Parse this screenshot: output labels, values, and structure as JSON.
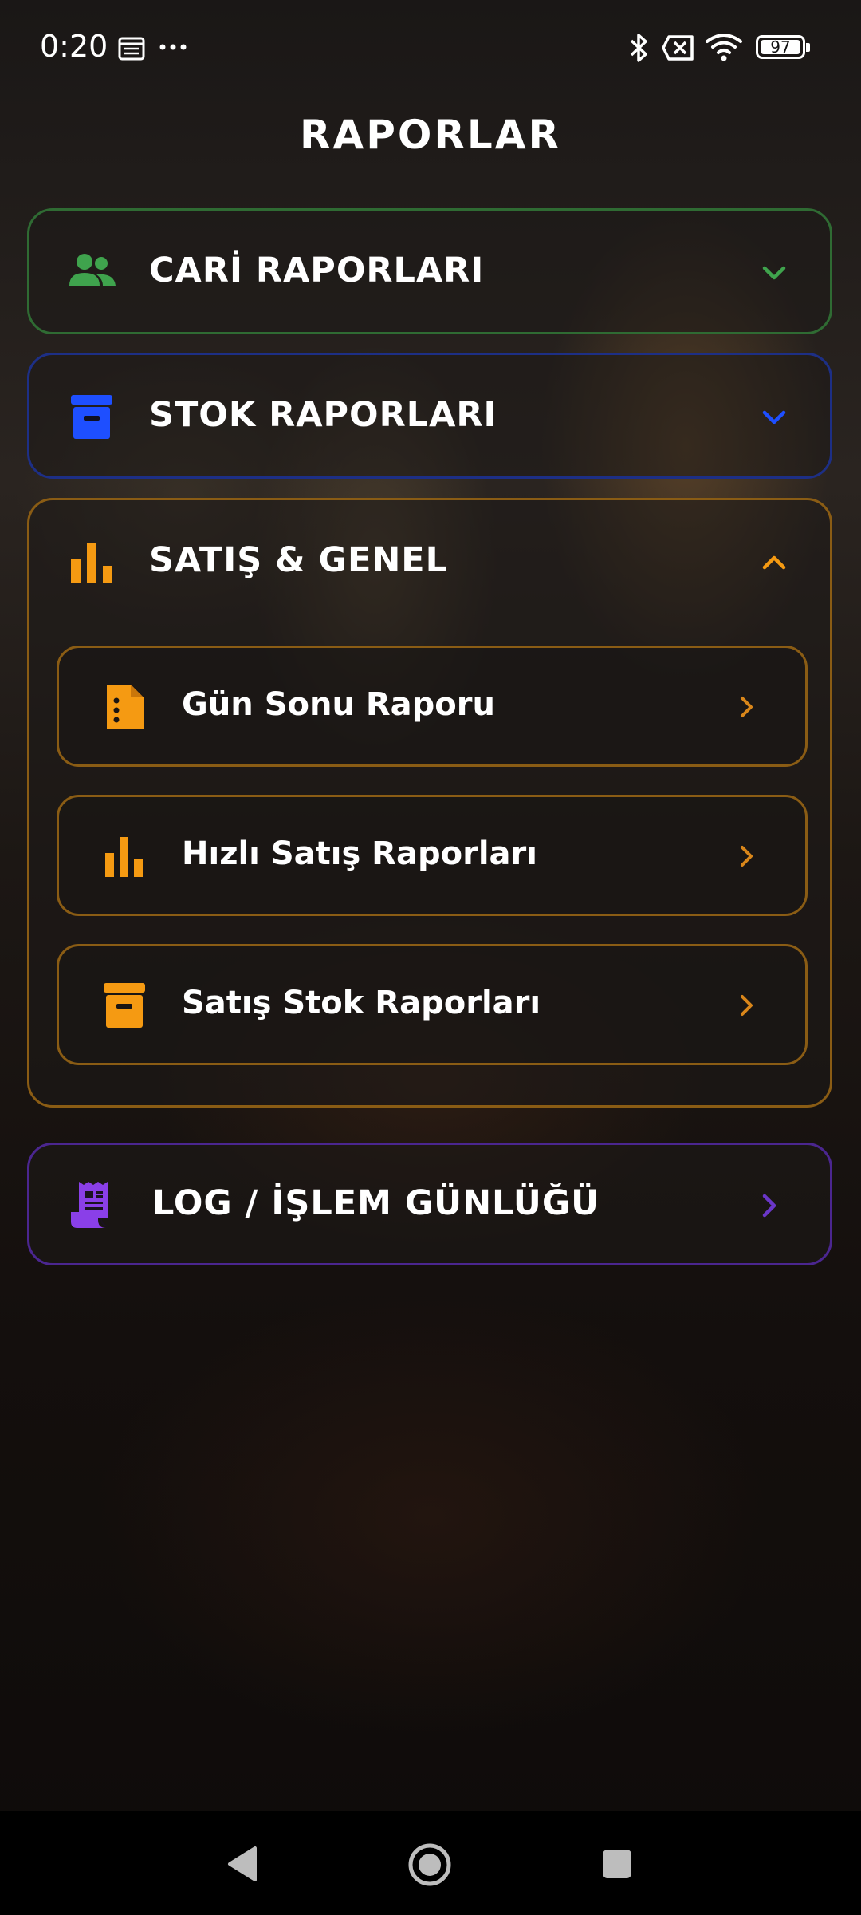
{
  "status_bar": {
    "time": "0:20",
    "battery": "97",
    "icons": [
      "calendar-icon",
      "more-dots-icon",
      "bluetooth-icon",
      "no-sim-icon",
      "wifi-icon",
      "battery-icon"
    ]
  },
  "header": {
    "title": "RAPORLAR"
  },
  "sections": {
    "cari": {
      "label": "CARİ RAPORLARI",
      "icon": "users-icon",
      "color": "#3fa34d",
      "expanded": false
    },
    "stok": {
      "label": "STOK RAPORLARI",
      "icon": "archive-box-icon",
      "color": "#1e4fff",
      "expanded": false
    },
    "satis": {
      "label": "SATIŞ & GENEL",
      "icon": "bar-chart-icon",
      "color": "#f59a12",
      "expanded": true,
      "items": [
        {
          "label": "Gün Sonu Raporu",
          "icon": "document-icon"
        },
        {
          "label": "Hızlı Satış Raporları",
          "icon": "bar-chart-icon"
        },
        {
          "label": "Satış Stok Raporları",
          "icon": "archive-box-icon"
        }
      ]
    },
    "log": {
      "label": "LOG / İŞLEM GÜNLÜĞÜ",
      "icon": "receipt-icon",
      "color": "#8a3fe8"
    }
  },
  "nav": {
    "icons": [
      "back-icon",
      "home-icon",
      "recents-icon"
    ]
  }
}
